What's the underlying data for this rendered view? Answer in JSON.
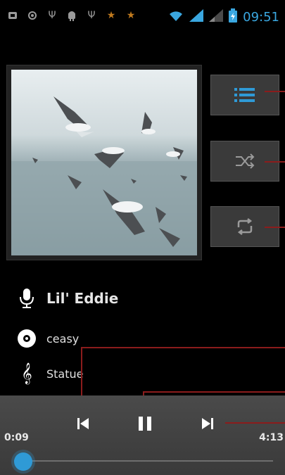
{
  "status_bar": {
    "time": "09:51",
    "icons": [
      "notification-icon",
      "sync-icon",
      "usb-icon",
      "android-icon",
      "usb-icon",
      "star-icon",
      "star-icon",
      "wifi-icon",
      "signal-icon",
      "signal-weak-icon",
      "battery-icon"
    ]
  },
  "player": {
    "artist": "Lil' Eddie",
    "album": "ceasy",
    "song": "Statue",
    "elapsed": "0:09",
    "duration": "4:13",
    "progress_fraction": 0.036
  },
  "side_controls": {
    "playlist_icon": "playlist-icon",
    "shuffle_icon": "shuffle-icon",
    "repeat_icon": "repeat-icon"
  },
  "colors": {
    "accent": "#2f9ad6",
    "callout": "#8b1c1c",
    "panel": "#3a3a3a"
  }
}
